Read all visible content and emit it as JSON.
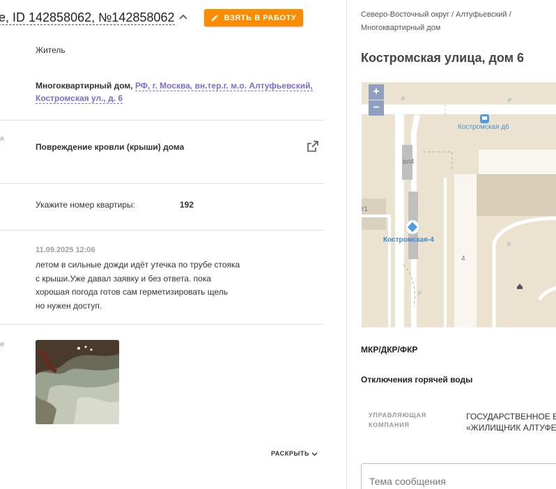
{
  "header": {
    "title": "e, ID 142858062, №142858062",
    "take_button_label": "ВЗЯТЬ В РАБОТУ"
  },
  "details": {
    "applicant_type": "Житель",
    "object_prefix": "Многоквартирный дом, ",
    "object_link_line1": "РФ, г. Москва, вн.тер.г. м.о. Алтуфьевский,",
    "object_link_line2": "Костромская ул., д. 6",
    "category_stub": "я",
    "problem": "Повреждение кровли (крыши) дома",
    "apartment_label": "Укажите номер квартиры:",
    "apartment_value": "192",
    "comment_date": "11.09.2025 12:06",
    "comment_lines": [
      "летом в сильные дожди идёт утечка по трубе стояка",
      "с крыши.Уже давал заявку и без ответа. пока",
      "хорошая погода готов сам герметизировать щель",
      "но нужен доступ."
    ],
    "photo_stub": "и",
    "expand_label": "РАСКРЫТЬ"
  },
  "right": {
    "breadcrumb_line1": "Северо-Восточный округ / Алтуфьевский /",
    "breadcrumb_line2": "Многоквартирный дом",
    "address": "Костромская улица, дом 6",
    "map": {
      "zoom_in": "+",
      "zoom_out": "−",
      "labels": {
        "bus_stop": "Костромская д6",
        "stop2": "Костромская-4",
        "building_vl4": "вл4",
        "building_r1": "r1",
        "building_4": "4",
        "parking": "P"
      }
    },
    "section_mkr": "МКР/ДКР/ФКР",
    "section_hot_water": "Отключения горячей воды",
    "mc_label_line1": "УПРАВЛЯЮЩАЯ",
    "mc_label_line2": "КОМПАНИЯ",
    "mc_value_line1": "ГОСУДАРСТВЕННОЕ Б",
    "mc_value_line2": "«ЖИЛИЩНИК АЛТУФЕ",
    "message_placeholder": "Тема сообщения"
  },
  "colors": {
    "accent_orange": "#fb8c00",
    "link_purple": "#7b6cd1",
    "map_marker": "#4f9ce0",
    "zoom_button": "#8f9fc0"
  }
}
